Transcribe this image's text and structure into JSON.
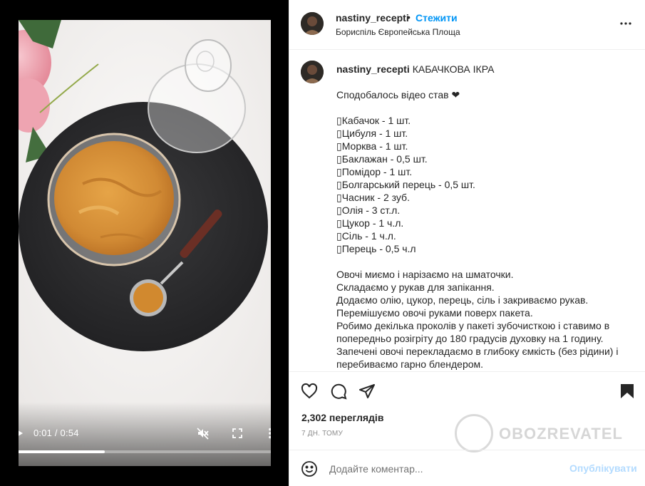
{
  "video": {
    "time": "0:01 / 0:54",
    "progress": 0.35
  },
  "post": {
    "username": "nastiny_recepti",
    "dot": "•",
    "follow_label": "Стежити",
    "location": "Бориспіль Європейська Площа",
    "caption": {
      "title": "КАБАЧКОВА ІКРА",
      "line_like": "Сподобалось відео став ❤",
      "ingredients": [
        "Кабачок - 1 шт.",
        "Цибуля - 1 шт.",
        "Морква - 1 шт.",
        "Баклажан - 0,5 шт.",
        "Помідор - 1 шт.",
        "Болгарський перець - 0,5 шт.",
        "Часник - 2 зуб.",
        "Олія - 3 ст.л.",
        "Цукор - 1 ч.л.",
        "Сіль - 1 ч.л.",
        "Перець - 0,5 ч.л"
      ],
      "ingredient_marker": "▯",
      "steps": [
        "Овочі миємо і нарізаємо на шматочки.",
        "Складаємо у рукав для запікання.",
        "Додаємо олію, цукор, перець, сіль і закриваємо рукав.",
        "Перемішуємо овочі руками поверх пакета.",
        "Робимо декілька проколів у пакеті зубочисткою і ставимо в попередньо розігріту до 180 градусів духовку на 1 годину.",
        "Запечені овочі перекладаємо в глибоку ємкість (без рідини) і перебиваємо гарно блендером."
      ]
    },
    "views": "2,302 переглядів",
    "age": "7 ДН. ТОМУ",
    "comment_placeholder": "Додайте коментар...",
    "post_label": "Опублікувати"
  },
  "watermark": {
    "text": "OBOZREVATEL"
  },
  "colors": {
    "accent": "#0095f6",
    "post_disabled": "#b3dbff",
    "text": "#262626",
    "muted": "#8e8e8e"
  },
  "icons": [
    "play-icon",
    "mute-icon",
    "fullscreen-icon",
    "more-vertical-icon",
    "more-horizontal-icon",
    "heart-icon",
    "comment-icon",
    "share-icon",
    "bookmark-icon",
    "emoji-icon"
  ]
}
